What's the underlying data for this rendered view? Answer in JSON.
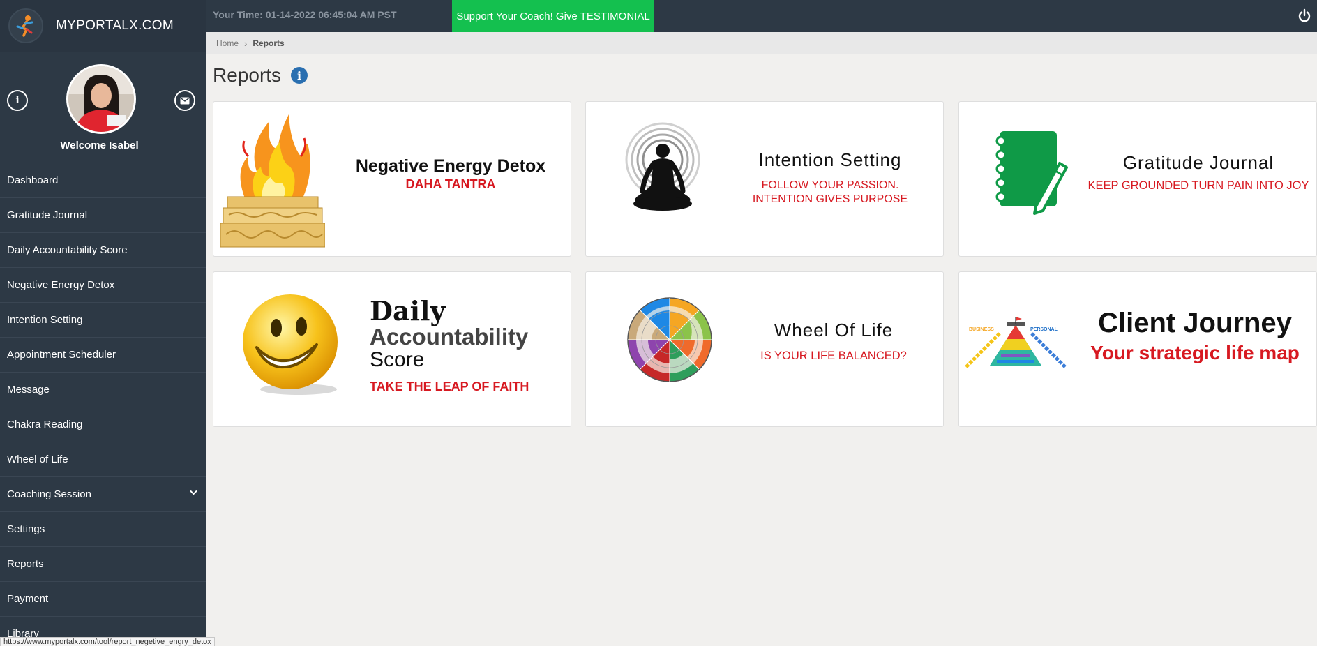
{
  "brand": {
    "name": "MYPORTALX.COM"
  },
  "topbar": {
    "time_label": "Your Time: 01-14-2022 06:45:04 AM PST",
    "support_button": "Support Your Coach! Give TESTIMONIAL"
  },
  "profile": {
    "welcome": "Welcome Isabel"
  },
  "menu": [
    {
      "label": "Dashboard"
    },
    {
      "label": "Gratitude Journal"
    },
    {
      "label": "Daily Accountability Score"
    },
    {
      "label": "Negative Energy Detox"
    },
    {
      "label": "Intention Setting"
    },
    {
      "label": "Appointment Scheduler"
    },
    {
      "label": "Message"
    },
    {
      "label": "Chakra Reading"
    },
    {
      "label": "Wheel of Life"
    },
    {
      "label": "Coaching Session"
    },
    {
      "label": "Settings"
    },
    {
      "label": "Reports"
    },
    {
      "label": "Payment"
    },
    {
      "label": "Library"
    }
  ],
  "breadcrumb": {
    "home": "Home",
    "current": "Reports"
  },
  "page": {
    "title": "Reports"
  },
  "cards": {
    "detox": {
      "title": "Negative Energy Detox",
      "subtitle": "DAHA TANTRA"
    },
    "intention": {
      "title": "Intention Setting",
      "line1": "FOLLOW YOUR PASSION.",
      "line2": "INTENTION GIVES PURPOSE"
    },
    "gratitude": {
      "title": "Gratitude Journal",
      "subtitle": "KEEP GROUNDED TURN PAIN INTO JOY"
    },
    "accountability": {
      "line1": "Daily",
      "line2": "Accountability",
      "line3": "Score",
      "subtitle": "TAKE THE LEAP OF FAITH"
    },
    "wheel": {
      "title": "Wheel Of Life",
      "subtitle": "IS YOUR LIFE BALANCED?"
    },
    "journey": {
      "title": "Client Journey",
      "subtitle": "Your strategic life map",
      "label_left": "BUSINESS",
      "label_right": "PERSONAL"
    }
  },
  "status_url": "https://www.myportalx.com/tool/report_negetive_engry_detox",
  "colors": {
    "sidebar": "#2d3945",
    "accent_green": "#14c04f",
    "subtitle_red": "#d71921",
    "info_blue": "#2a6fb0"
  }
}
